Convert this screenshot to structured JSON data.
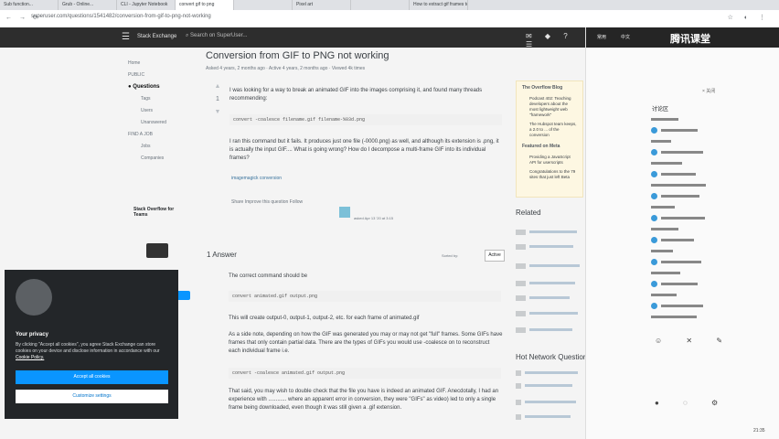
{
  "browser": {
    "tabs": [
      "Sub function...",
      "Grub - Online...",
      "CLI - Jupyter Notebook",
      "convert gif to png",
      "",
      "Pixel art",
      "",
      "How to extract gif frames to"
    ],
    "url": "superuser.com/questions/1541482/conversion-from-gif-to-png-not-working"
  },
  "header": {
    "logo": "Stack Exchange",
    "search_placeholder": "Search on SuperUser..."
  },
  "leftnav": {
    "home": "Home",
    "public": "PUBLIC",
    "questions": "Questions",
    "tags": "Tags",
    "users": "Users",
    "unanswered": "Unanswered",
    "find_job": "FIND A JOB",
    "jobs": "Jobs",
    "companies": "Companies",
    "teams_title": "Stack Overflow for Teams"
  },
  "question": {
    "title": "Conversion from GIF to PNG not working",
    "meta": "Asked 4 years, 2 months ago · Active 4 years, 2 months ago · Viewed 4k times",
    "vote_count": "1",
    "body1": "I was looking for a way to break an animated GIF into the images comprising it, and found many threads recommending:",
    "code1": "convert -coalesce filename.gif filename-%03d.png",
    "body2": "I ran this command but it fails. It produces just one file (-0000.png) as well, and although its extension is .png, it is actually the input GIF.... What is going wrong? How do I decompose a multi-frame GIF into its individual frames?",
    "tags": "imagemagick  conversion",
    "share_line": "Share   Improve this question   Follow",
    "asker": "asked Apr 13 '20 at 3:15"
  },
  "answers": {
    "heading": "1 Answer",
    "sort_label": "Sorted by:",
    "sort_value": "Active",
    "a1": "The correct command should be",
    "code_a1": "convert animated.gif output.png",
    "a2": "This will create output-0, output-1, output-2, etc. for each frame of animated.gif",
    "a3": "As a side note, depending on how the GIF was generated you may or may not get \"full\" frames. Some GIFs have frames that only contain partial data. There are the types of GIFs you would use -coalesce on to reconstruct each individual frame i.e.",
    "code_a2": "convert -coalesce animated.gif output.png",
    "a4": "That said, you may wish to double check that the file you have is indeed an animated GIF. Anecdotally, I had an experience with ............ where an apparent error in conversion, they were \"GIFs\" as video) led to only a single frame being downloaded, even though it was still given a .gif extension."
  },
  "widget": {
    "heading": "The Overflow Blog",
    "item1": "Podcast 402: Teaching developers about the most lightweight web \"framework\"",
    "item2": "The Hubspot team keeps, a 2.0 to ... of the conversion",
    "heading2": "Featured on Meta",
    "item3": "Providing a JavaScript API for userscripts",
    "item4": "Congratulations to the 79 sites that just left Beta"
  },
  "sidebar": {
    "related": "Related",
    "hot_network": "Hot Network Questions"
  },
  "cookie": {
    "title": "Your privacy",
    "text": "By clicking \"Accept all cookies\", you agree Stack Exchange can store cookies on your device and disclose information in accordance with our",
    "link": "Cookie Policy.",
    "accept": "Accept all cookies",
    "customize": "Customize settings"
  },
  "sidepanel": {
    "tab1": "常用",
    "tab2": "中文",
    "brand": "腾讯课堂",
    "section": "讨论区",
    "close": "× 关闭"
  },
  "clock": "21:35"
}
